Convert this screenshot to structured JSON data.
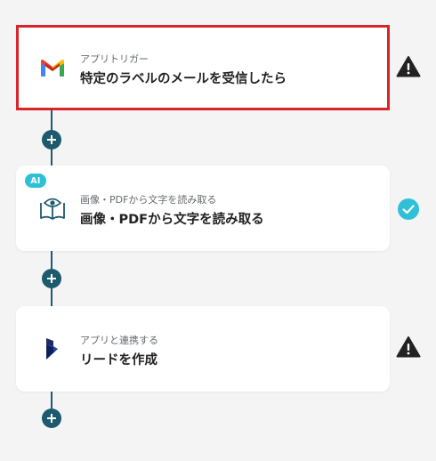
{
  "steps": [
    {
      "type_label": "アプリトリガー",
      "title": "特定のラベルのメールを受信したら",
      "icon": "gmail-icon",
      "status": "warning"
    },
    {
      "badge": "AI",
      "type_label": "画像・PDFから文字を読み取る",
      "title": "画像・PDFから文字を読み取る",
      "icon": "open-book-eye-icon",
      "status": "complete"
    },
    {
      "type_label": "アプリと連携する",
      "title": "リードを作成",
      "icon": "dynamics-icon",
      "status": "warning"
    }
  ],
  "colors": {
    "background": "#f4f4f5",
    "connector": "#1e5a6e",
    "selected_border": "#d9252a",
    "ai_badge": "#2fc0d8",
    "check": "#2fc0d8",
    "warning": "#222222"
  }
}
